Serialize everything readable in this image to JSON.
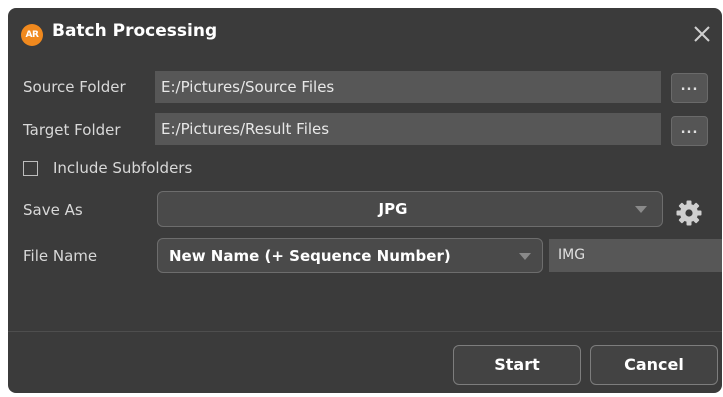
{
  "window": {
    "logo_text": "AR",
    "title": "Batch Processing",
    "close_icon": "close-icon"
  },
  "source": {
    "label": "Source Folder",
    "value": "E:/Pictures/Source Files",
    "browse_label": "..."
  },
  "target": {
    "label": "Target Folder",
    "value": "E:/Pictures/Result Files",
    "browse_label": "..."
  },
  "include_subfolders": {
    "label": "Include Subfolders",
    "checked": false
  },
  "save_as": {
    "label": "Save As",
    "selected": "JPG",
    "settings_icon": "gear-icon"
  },
  "file_name": {
    "label": "File Name",
    "selected": "New Name (+ Sequence Number)",
    "value": "IMG"
  },
  "actions": {
    "start_label": "Start",
    "cancel_label": "Cancel"
  },
  "colors": {
    "dialog_bg": "#3b3b3b",
    "field_bg": "#575757",
    "logo": "#f0891e"
  }
}
